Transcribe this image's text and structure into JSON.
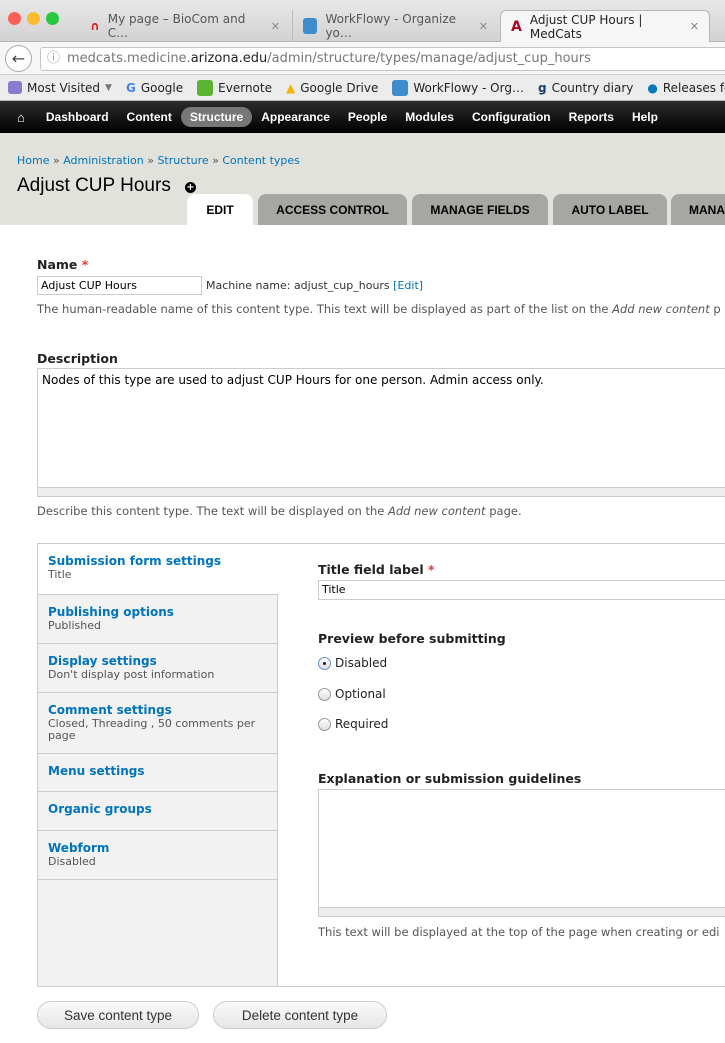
{
  "browser": {
    "tabs": [
      {
        "title": "My page – BioCom and C…",
        "close": "✕"
      },
      {
        "title": "WorkFlowy - Organize yo…",
        "close": "✕"
      },
      {
        "title": "Adjust CUP Hours | MedCats",
        "close": "✕"
      }
    ],
    "url_host_pre": "medcats.medicine.",
    "url_host_main": "arizona.edu",
    "url_path": "/admin/structure/types/manage/adjust_cup_hours",
    "bookmarks": [
      "Most Visited",
      "Google",
      "Evernote",
      "Google Drive",
      "WorkFlowy - Org…",
      "Country diary",
      "Releases for"
    ]
  },
  "toolbar": {
    "items": [
      "Dashboard",
      "Content",
      "Structure",
      "Appearance",
      "People",
      "Modules",
      "Configuration",
      "Reports",
      "Help"
    ]
  },
  "breadcrumb": [
    "Home",
    "Administration",
    "Structure",
    "Content types"
  ],
  "breadcrumb_sep": "»",
  "page_title": "Adjust CUP Hours",
  "page_tabs": [
    "EDIT",
    "ACCESS CONTROL",
    "MANAGE FIELDS",
    "AUTO LABEL",
    "MANA"
  ],
  "form": {
    "name_label": "Name",
    "required": "*",
    "name_value": "Adjust CUP Hours",
    "machine_name": "Machine name: adjust_cup_hours",
    "machine_edit": "[Edit]",
    "name_help_pre": "The human-readable name of this content type. This text will be displayed as part of the list on the ",
    "name_help_em": "Add new content",
    "name_help_post": " p",
    "desc_label": "Description",
    "desc_value": "Nodes of this type are used to adjust CUP Hours for one person. Admin access only.",
    "desc_help_pre": "Describe this content type. The text will be displayed on the ",
    "desc_help_em": "Add new content",
    "desc_help_post": " page."
  },
  "vertical_tabs": [
    {
      "title": "Submission form settings",
      "summary": "Title"
    },
    {
      "title": "Publishing options",
      "summary": "Published"
    },
    {
      "title": "Display settings",
      "summary": "Don't display post information"
    },
    {
      "title": "Comment settings",
      "summary": "Closed, Threading , 50 comments per page"
    },
    {
      "title": "Menu settings",
      "summary": ""
    },
    {
      "title": "Organic groups",
      "summary": ""
    },
    {
      "title": "Webform",
      "summary": "Disabled"
    }
  ],
  "submission": {
    "title_label": "Title field label",
    "title_value": "Title",
    "preview_label": "Preview before submitting",
    "options": [
      "Disabled",
      "Optional",
      "Required"
    ],
    "selected": "Disabled",
    "guide_label": "Explanation or submission guidelines",
    "guide_help": "This text will be displayed at the top of the page when creating or edi"
  },
  "actions": {
    "save": "Save content type",
    "delete": "Delete content type"
  }
}
